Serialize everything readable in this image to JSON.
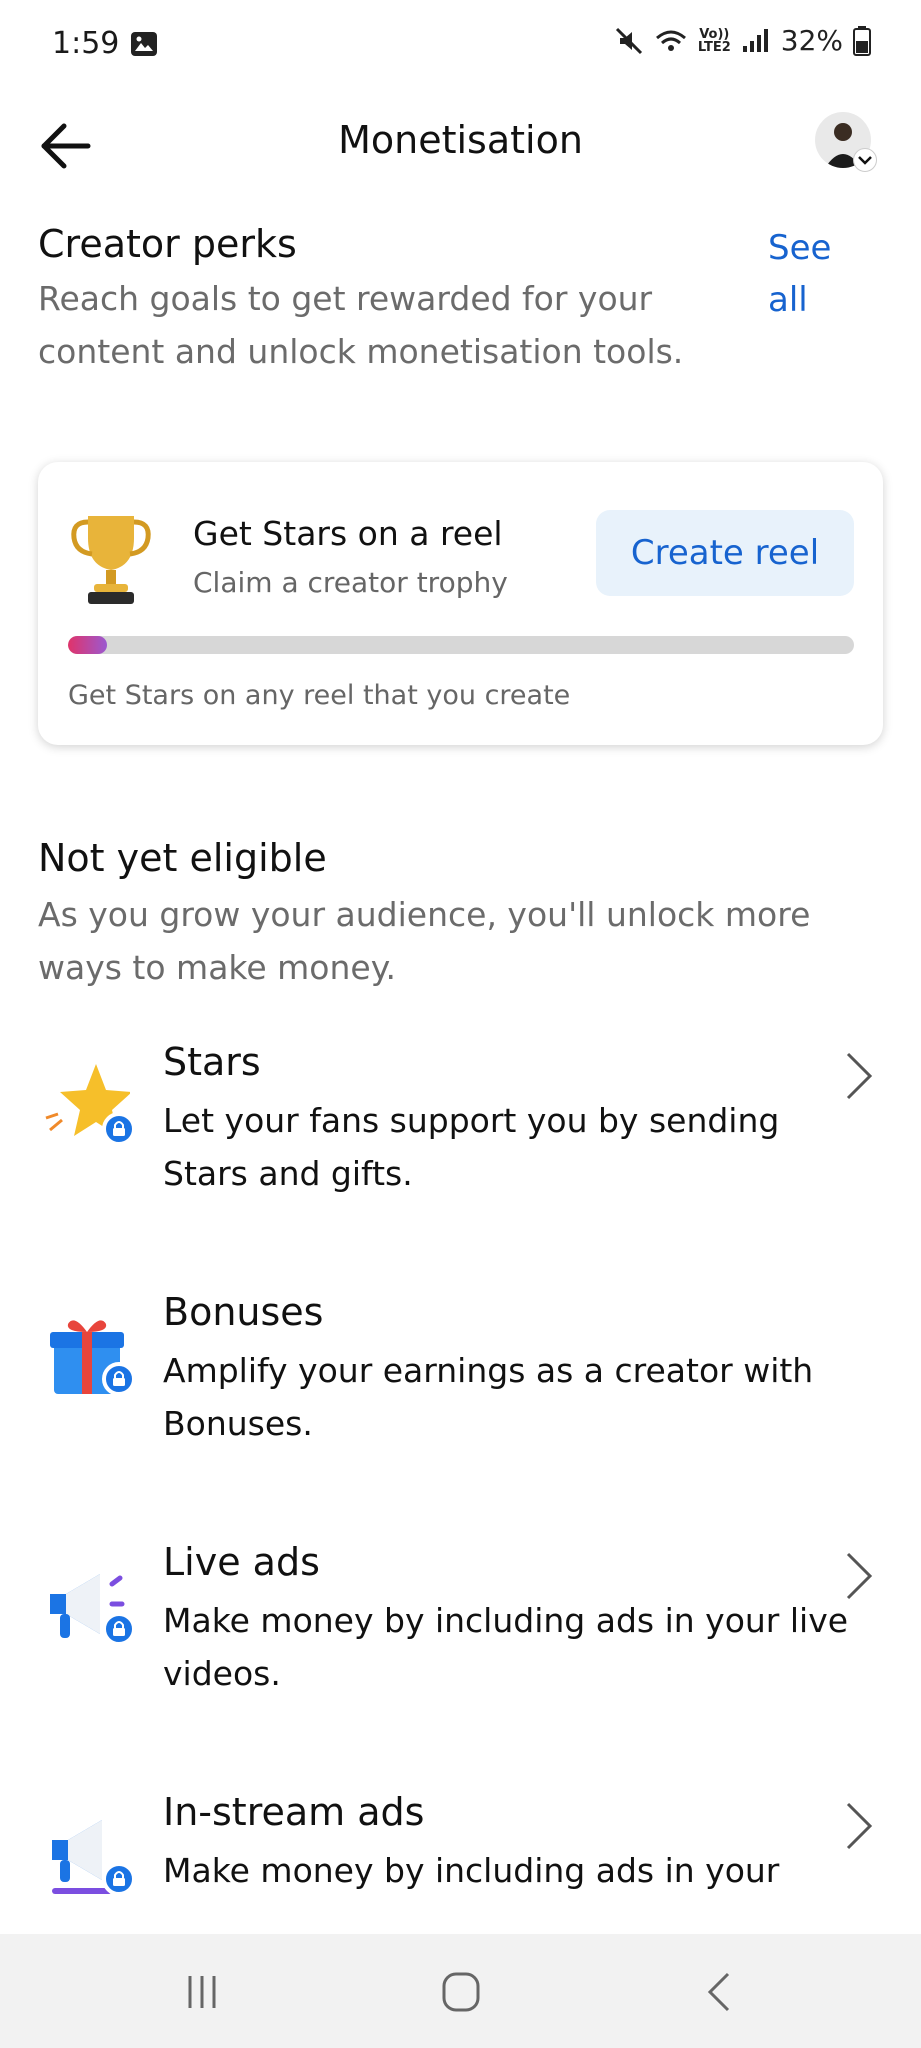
{
  "status": {
    "time": "1:59",
    "net_top": "Vo))",
    "net_bottom": "LTE2",
    "battery": "32%"
  },
  "header": {
    "title": "Monetisation"
  },
  "perks": {
    "title": "Creator perks",
    "description": "Reach goals to get rewarded for your content and unlock monetisation tools.",
    "see_all": "See all",
    "card": {
      "title": "Get Stars on a reel",
      "subtitle": "Claim a creator trophy",
      "button": "Create reel",
      "progress": 0.05,
      "hint": "Get Stars on any reel that you create"
    }
  },
  "eligible": {
    "title": "Not yet eligible",
    "description": "As you grow your audience, you'll unlock more ways to make money.",
    "items": [
      {
        "title": "Stars",
        "description": "Let your fans support you by sending Stars and gifts.",
        "icon": "star-icon"
      },
      {
        "title": "Bonuses",
        "description": "Amplify your earnings as a creator with Bonuses.",
        "icon": "gift-icon"
      },
      {
        "title": "Live ads",
        "description": "Make money by including ads in your live videos.",
        "icon": "megaphone-icon"
      },
      {
        "title": "In-stream ads",
        "description": "Make money by including ads in your",
        "icon": "megaphone-play-icon"
      }
    ]
  },
  "colors": {
    "accent": "#1763cf",
    "lock": "#1b74e4",
    "button_bg": "#e8f2fb"
  }
}
